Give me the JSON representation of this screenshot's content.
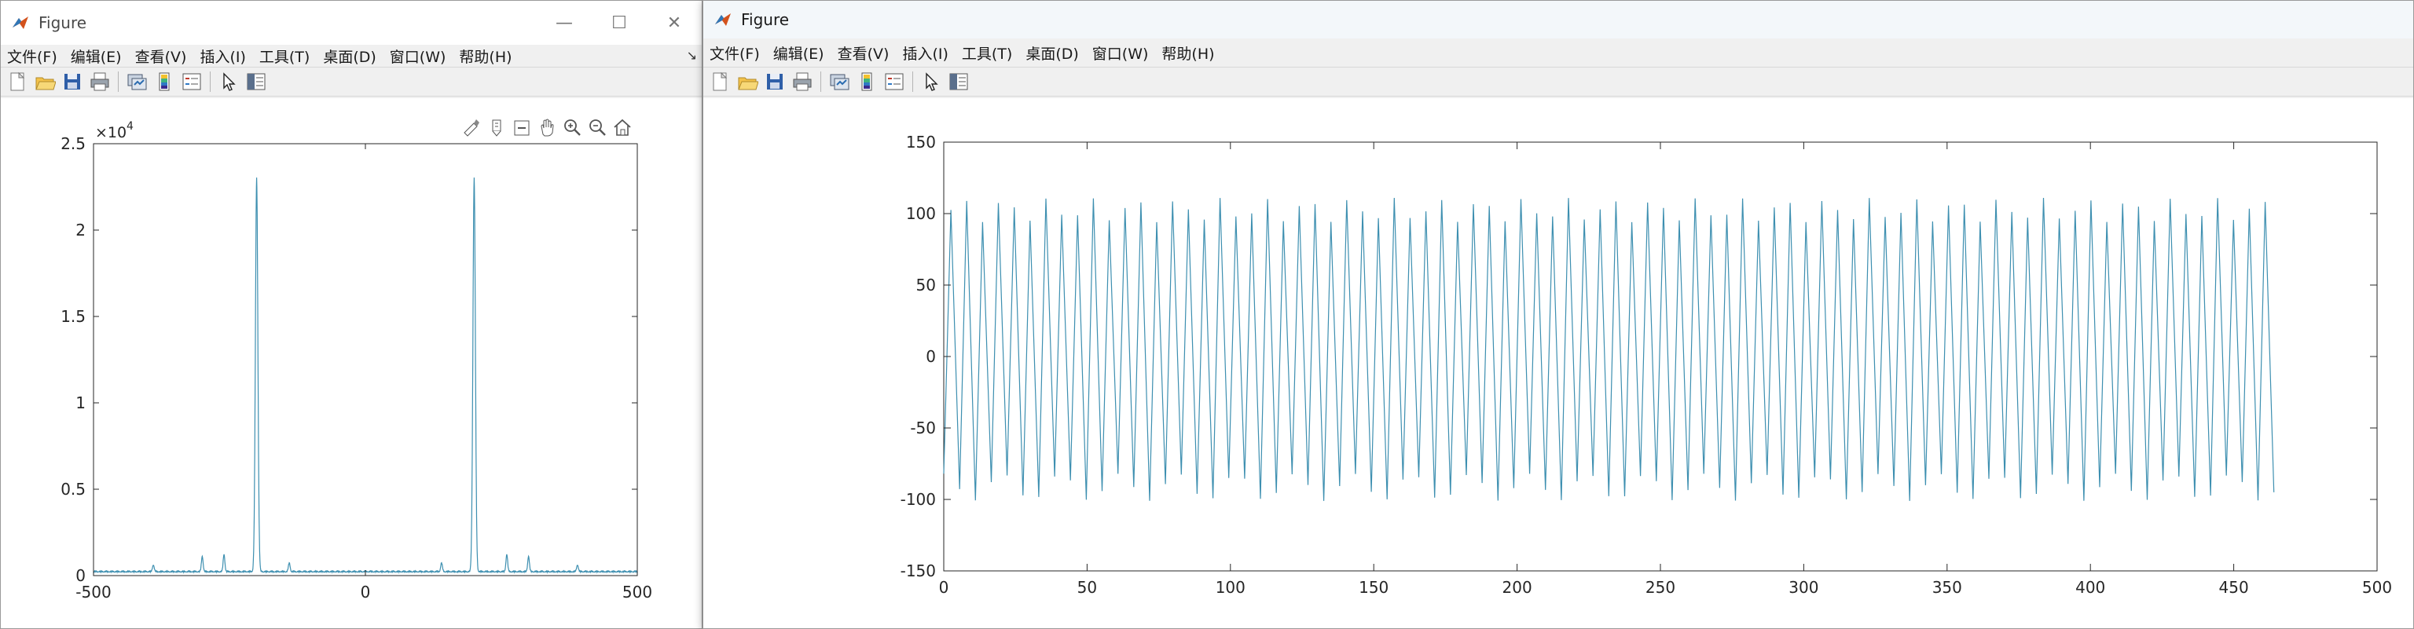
{
  "left_window": {
    "title": "Figure",
    "controls": {
      "minimize": "—",
      "maximize": "☐",
      "close": "✕"
    },
    "menu": [
      "文件(F)",
      "编辑(E)",
      "查看(V)",
      "插入(I)",
      "工具(T)",
      "桌面(D)",
      "窗口(W)",
      "帮助(H)"
    ],
    "toolbar_icons": [
      "new-figure-icon",
      "open-file-icon",
      "save-icon",
      "print-icon",
      "link-plot-icon",
      "insert-colorbar-icon",
      "insert-legend-icon",
      "edit-plot-icon",
      "property-inspector-icon"
    ],
    "axes_toolbar_icons": [
      "brush-icon",
      "data-tips-icon",
      "restore-view-icon",
      "pan-icon",
      "zoom-in-icon",
      "zoom-out-icon",
      "home-icon"
    ]
  },
  "right_window": {
    "title": "Figure",
    "menu": [
      "文件(F)",
      "编辑(E)",
      "查看(V)",
      "插入(I)",
      "工具(T)",
      "桌面(D)",
      "窗口(W)",
      "帮助(H)"
    ],
    "toolbar_icons": [
      "new-figure-icon",
      "open-file-icon",
      "save-icon",
      "print-icon",
      "link-plot-icon",
      "insert-colorbar-icon",
      "insert-legend-icon",
      "edit-plot-icon",
      "property-inspector-icon"
    ]
  },
  "chart_data": [
    {
      "type": "line",
      "title": "",
      "xlabel": "",
      "ylabel": "",
      "xlim": [
        -500,
        500
      ],
      "ylim": [
        0,
        25000
      ],
      "xticks": [
        "-500",
        "0",
        "500"
      ],
      "yticks": [
        "0",
        "0.5",
        "1",
        "1.5",
        "2",
        "2.5"
      ],
      "y_exponent_label": "×10",
      "y_exponent_power": "4",
      "grid": false,
      "color": "#3d8fb0",
      "peaks": [
        {
          "x": -200,
          "y": 22800
        },
        {
          "x": 200,
          "y": 22800
        },
        {
          "x": -300,
          "y": 900
        },
        {
          "x": 300,
          "y": 900
        },
        {
          "x": -260,
          "y": 1000
        },
        {
          "x": 260,
          "y": 1000
        },
        {
          "x": -140,
          "y": 500
        },
        {
          "x": 140,
          "y": 500
        },
        {
          "x": -390,
          "y": 400
        },
        {
          "x": 390,
          "y": 400
        }
      ],
      "baseline": 200
    },
    {
      "type": "line",
      "title": "",
      "xlabel": "",
      "ylabel": "",
      "xlim": [
        0,
        500
      ],
      "ylim": [
        -150,
        150
      ],
      "xticks": [
        "0",
        "50",
        "100",
        "150",
        "200",
        "250",
        "300",
        "350",
        "400",
        "450",
        "500"
      ],
      "yticks": [
        "-150",
        "-100",
        "-50",
        "0",
        "50",
        "100",
        "150"
      ],
      "grid": false,
      "color": "#3d8fb0",
      "signal": {
        "x_start": 0,
        "x_end": 464,
        "cycles": 84,
        "peak_high": 111,
        "peak_low": 94,
        "trough_low": -101,
        "trough_high": -82
      }
    }
  ]
}
